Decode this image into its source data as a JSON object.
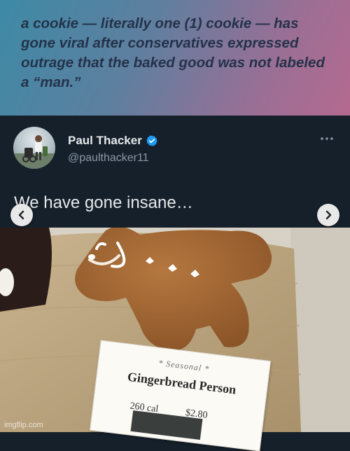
{
  "headline": {
    "text": "a cookie — literally one (1) cookie — has gone viral after conservatives expressed outrage that the baked good was not labeled a “man.”"
  },
  "tweet": {
    "display_name": "Paul Thacker",
    "handle": "@paulthacker11",
    "verified": true,
    "text": "We have gone insane…",
    "icons": {
      "verified": "verified-badge-icon",
      "more": "more-options-icon",
      "prev": "chevron-left-icon",
      "next": "chevron-right-icon"
    }
  },
  "photo": {
    "sign": {
      "seasonal": "* Seasonal *",
      "title": "Gingerbread Person",
      "calories": "260 cal",
      "price": "$2.80"
    }
  },
  "watermark": "imgflip.com",
  "colors": {
    "tweet_bg": "#15202b",
    "verified_blue": "#1d9bf0",
    "name_text": "#e7e9ea",
    "handle_text": "#8b98a5",
    "headline_text": "#24324a"
  }
}
